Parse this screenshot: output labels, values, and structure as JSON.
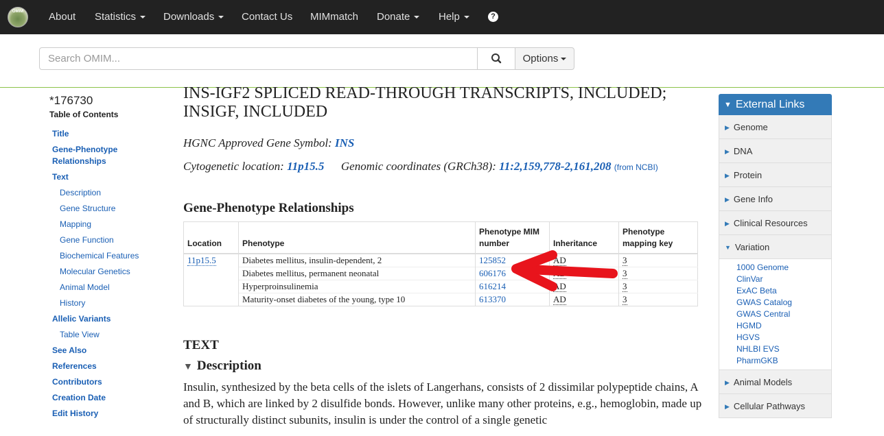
{
  "nav": {
    "logo_text": "OMIM",
    "items": [
      {
        "label": "About",
        "dropdown": false
      },
      {
        "label": "Statistics",
        "dropdown": true
      },
      {
        "label": "Downloads",
        "dropdown": true
      },
      {
        "label": "Contact Us",
        "dropdown": false
      },
      {
        "label": "MIMmatch",
        "dropdown": false
      },
      {
        "label": "Donate",
        "dropdown": true
      },
      {
        "label": "Help",
        "dropdown": true
      }
    ],
    "help_icon": "?"
  },
  "search": {
    "placeholder": "Search OMIM...",
    "options_label": "Options"
  },
  "toc": {
    "mim_number": "*176730",
    "title": "Table of Contents",
    "items": [
      {
        "label": "Title",
        "bold": true
      },
      {
        "label": "Gene-Phenotype Relationships",
        "bold": true
      },
      {
        "label": "Text",
        "bold": true
      },
      {
        "label": "Description",
        "bold": false
      },
      {
        "label": "Gene Structure",
        "bold": false
      },
      {
        "label": "Mapping",
        "bold": false
      },
      {
        "label": "Gene Function",
        "bold": false
      },
      {
        "label": "Biochemical Features",
        "bold": false
      },
      {
        "label": "Molecular Genetics",
        "bold": false
      },
      {
        "label": "Animal Model",
        "bold": false
      },
      {
        "label": "History",
        "bold": false
      },
      {
        "label": "Allelic Variants",
        "bold": true
      },
      {
        "label": "Table View",
        "bold": false
      },
      {
        "label": "See Also",
        "bold": true
      },
      {
        "label": "References",
        "bold": true
      },
      {
        "label": "Contributors",
        "bold": true
      },
      {
        "label": "Creation Date",
        "bold": true
      },
      {
        "label": "Edit History",
        "bold": true
      }
    ]
  },
  "main": {
    "title": "INS-IGF2 SPLICED READ-THROUGH TRANSCRIPTS, INCLUDED; INSIGF, INCLUDED",
    "hgnc_label": "HGNC Approved Gene Symbol:",
    "hgnc_value": "INS",
    "cyto_label": "Cytogenetic location:",
    "cyto_value": "11p15.5",
    "genomic_label": "Genomic coordinates (GRCh38):",
    "genomic_value": "11:2,159,778-2,161,208",
    "genomic_source": "(from NCBI)",
    "gp_heading": "Gene-Phenotype Relationships",
    "table": {
      "headers": [
        "Location",
        "Phenotype",
        "Phenotype MIM number",
        "Inheritance",
        "Phenotype mapping key"
      ],
      "location": "11p15.5",
      "rows": [
        {
          "phenotype": "Diabetes mellitus, insulin-dependent, 2",
          "mim": "125852",
          "inheritance": "AD",
          "key": "3"
        },
        {
          "phenotype": "Diabetes mellitus, permanent neonatal",
          "mim": "606176",
          "inheritance": "AD",
          "key": "3"
        },
        {
          "phenotype": "Hyperproinsulinemia",
          "mim": "616214",
          "inheritance": "AD",
          "key": "3"
        },
        {
          "phenotype": "Maturity-onset diabetes of the young, type 10",
          "mim": "613370",
          "inheritance": "AD",
          "key": "3"
        }
      ]
    },
    "text_heading": "TEXT",
    "description_heading": "Description",
    "description_text": "Insulin, synthesized by the beta cells of the islets of Langerhans, consists of 2 dissimilar polypeptide chains, A and B, which are linked by 2 disulfide bonds. However, unlike many other proteins, e.g., hemoglobin, made up of structurally distinct subunits, insulin is under the control of a single genetic"
  },
  "external_links": {
    "heading": "External Links",
    "sections_before": [
      "Genome",
      "DNA",
      "Protein",
      "Gene Info",
      "Clinical Resources"
    ],
    "expanded": "Variation",
    "variation_links": [
      "1000 Genome",
      "ClinVar",
      "ExAC Beta",
      "GWAS Catalog",
      "GWAS Central",
      "HGMD",
      "HGVS",
      "NHLBI EVS",
      "PharmGKB"
    ],
    "sections_after": [
      "Animal Models",
      "Cellular Pathways"
    ]
  },
  "colors": {
    "navbar": "#222222",
    "link": "#1a5fb4",
    "panel_header": "#337ab7",
    "annotation_arrow": "#e8141c",
    "divider": "#8bc34a"
  }
}
